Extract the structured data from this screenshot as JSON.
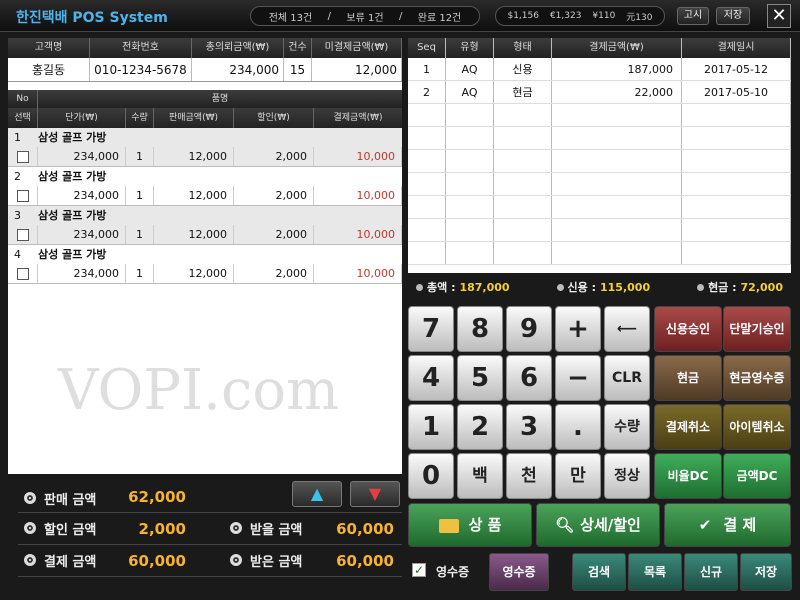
{
  "header": {
    "title": "한진택배 POS System",
    "counts": {
      "total": "전체 13건",
      "hold": "보류 1건",
      "done": "완료 12건",
      "sep": "/"
    },
    "currency": {
      "usd": "$1,156",
      "eur": "€1,323",
      "jpy": "¥110",
      "cny": "元130"
    },
    "notice_label": "고시",
    "save_label": "저장",
    "close_label": "✕"
  },
  "customer": {
    "headers": [
      "고객명",
      "전화번호",
      "총의뢰금액(₩)",
      "건수",
      "미결제금액(₩)"
    ],
    "name": "홍길동",
    "phone": "010-1234-5678",
    "total": "234,000",
    "count": "15",
    "unpaid": "12,000"
  },
  "items_header": {
    "no": "No",
    "name": "품명",
    "select": "선택",
    "price": "단가(₩)",
    "qty": "수량",
    "sale": "판매금액(₩)",
    "discount": "할인(₩)",
    "payment": "결제금액(₩)"
  },
  "items": [
    {
      "no": "1",
      "name": "삼성 골프 가방",
      "price": "234,000",
      "qty": "1",
      "sale": "12,000",
      "discount": "2,000",
      "payment": "10,000"
    },
    {
      "no": "2",
      "name": "삼성 골프 가방",
      "price": "234,000",
      "qty": "1",
      "sale": "12,000",
      "discount": "2,000",
      "payment": "10,000"
    },
    {
      "no": "3",
      "name": "삼성 골프 가방",
      "price": "234,000",
      "qty": "1",
      "sale": "12,000",
      "discount": "2,000",
      "payment": "10,000"
    },
    {
      "no": "4",
      "name": "삼성 골프 가방",
      "price": "234,000",
      "qty": "1",
      "sale": "12,000",
      "discount": "2,000",
      "payment": "10,000"
    }
  ],
  "watermark": "VOPI.com",
  "totals": {
    "sale_label": "판매 금액",
    "sale": "62,000",
    "discount_label": "할인 금액",
    "discount": "2,000",
    "pay_label": "결제 금액",
    "pay": "60,000",
    "receivable_label": "받을 금액",
    "receivable": "60,000",
    "received_label": "받은 금액",
    "received": "60,000",
    "up_arrow": "▲",
    "down_arrow": "▼"
  },
  "payments": {
    "headers": [
      "Seq",
      "유형",
      "형태",
      "결제금액(₩)",
      "결제일시"
    ],
    "rows": [
      {
        "seq": "1",
        "type": "AQ",
        "form": "신용",
        "amount": "187,000",
        "date": "2017-05-12"
      },
      {
        "seq": "2",
        "type": "AQ",
        "form": "현금",
        "amount": "22,000",
        "date": "2017-05-10"
      }
    ]
  },
  "summary": {
    "total_label": "총액 :",
    "total": "187,000",
    "credit_label": "신용 :",
    "credit": "115,000",
    "cash_label": "현금 :",
    "cash": "72,000"
  },
  "keypad": {
    "k7": "7",
    "k8": "8",
    "k9": "9",
    "plus": "+",
    "back": "⟵",
    "k4": "4",
    "k5": "5",
    "k6": "6",
    "minus": "−",
    "clr": "CLR",
    "k1": "1",
    "k2": "2",
    "k3": "3",
    "dot": ".",
    "qty": "수량",
    "k0": "0",
    "hundred": "백",
    "thousand": "천",
    "tenthousand": "만",
    "normal": "정상"
  },
  "functions": {
    "credit_approve": "신용승인",
    "terminal_approve": "단말기승인",
    "cash": "현금",
    "cash_receipt": "현금영수증",
    "pay_cancel": "결제취소",
    "item_cancel": "아이템취소",
    "ratio_dc": "비율DC",
    "amount_dc": "금액DC"
  },
  "big_buttons": {
    "product": "상 품",
    "detail": "상세/할인",
    "pay": "결 제"
  },
  "bottom": {
    "receipt_check": "영수증",
    "receipt_btn": "영수증",
    "search": "검색",
    "list": "목록",
    "new": "신규",
    "save": "저장"
  },
  "colors": {
    "accent_orange": "#f5b233",
    "title_blue": "#4fb3e8",
    "payment_red": "#c0392b"
  }
}
